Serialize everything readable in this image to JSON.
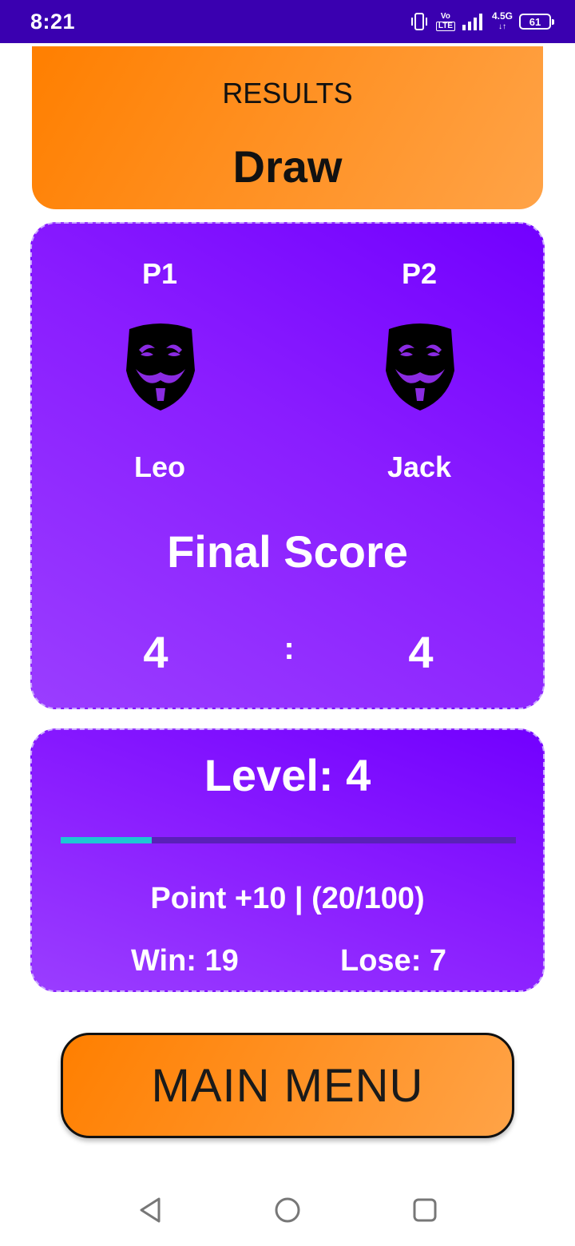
{
  "status_bar": {
    "time": "8:21",
    "volte_top": "Vo",
    "volte_bottom": "LTE",
    "network_type": "4.5G",
    "battery": "61",
    "icons": [
      "vibrate-icon",
      "volte-icon",
      "signal-icon",
      "network-type-icon",
      "battery-icon"
    ]
  },
  "results": {
    "label": "RESULTS",
    "value": "Draw"
  },
  "players": {
    "p1": {
      "tag": "P1",
      "name": "Leo",
      "avatar": "mask-icon"
    },
    "p2": {
      "tag": "P2",
      "name": "Jack",
      "avatar": "mask-icon"
    },
    "final_label": "Final Score",
    "score_p1": "4",
    "separator": ":",
    "score_p2": "4"
  },
  "level": {
    "title": "Level: 4",
    "progress_fraction": 0.2,
    "points": "Point +10 | (20/100)",
    "win": "Win: 19",
    "lose": "Lose: 7"
  },
  "actions": {
    "main_menu": "MAIN MENU"
  },
  "nav": {
    "icons": [
      "back-icon",
      "home-icon",
      "recents-icon"
    ]
  },
  "colors": {
    "status_bar": "#3a00b0",
    "orange": "#ff7f00",
    "purple": "#7200ff",
    "progress": "#1ec6d4"
  }
}
